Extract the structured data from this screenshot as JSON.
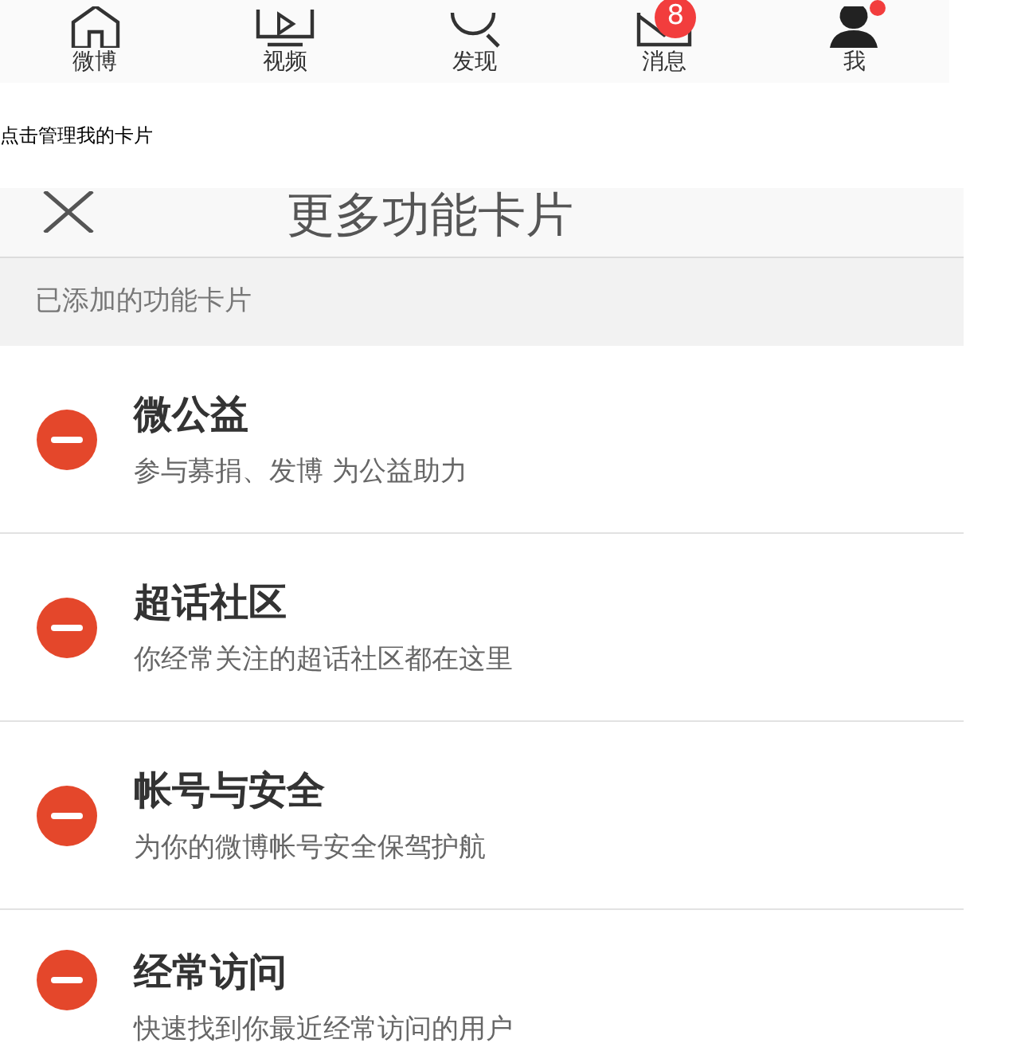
{
  "tab_bar": {
    "tabs": [
      {
        "label": "微博",
        "kind": "home",
        "dot": false
      },
      {
        "label": "视频",
        "kind": "video",
        "dot": false
      },
      {
        "label": "发现",
        "kind": "search",
        "dot": false
      },
      {
        "label": "消息",
        "kind": "mail",
        "badge": "8",
        "dot": false
      },
      {
        "label": "我",
        "kind": "profile",
        "dot": true
      }
    ]
  },
  "caption": "点击管理我的卡片",
  "panel": {
    "title": "更多功能卡片",
    "section_label": "已添加的功能卡片",
    "cards": [
      {
        "title": "微公益",
        "description": "参与募捐、发博 为公益助力"
      },
      {
        "title": "超话社区",
        "description": "你经常关注的超话社区都在这里"
      },
      {
        "title": "帐号与安全",
        "description": "为你的微博帐号安全保驾护航"
      },
      {
        "title": "经常访问",
        "description": "快速找到你最近经常访问的用户"
      }
    ]
  }
}
